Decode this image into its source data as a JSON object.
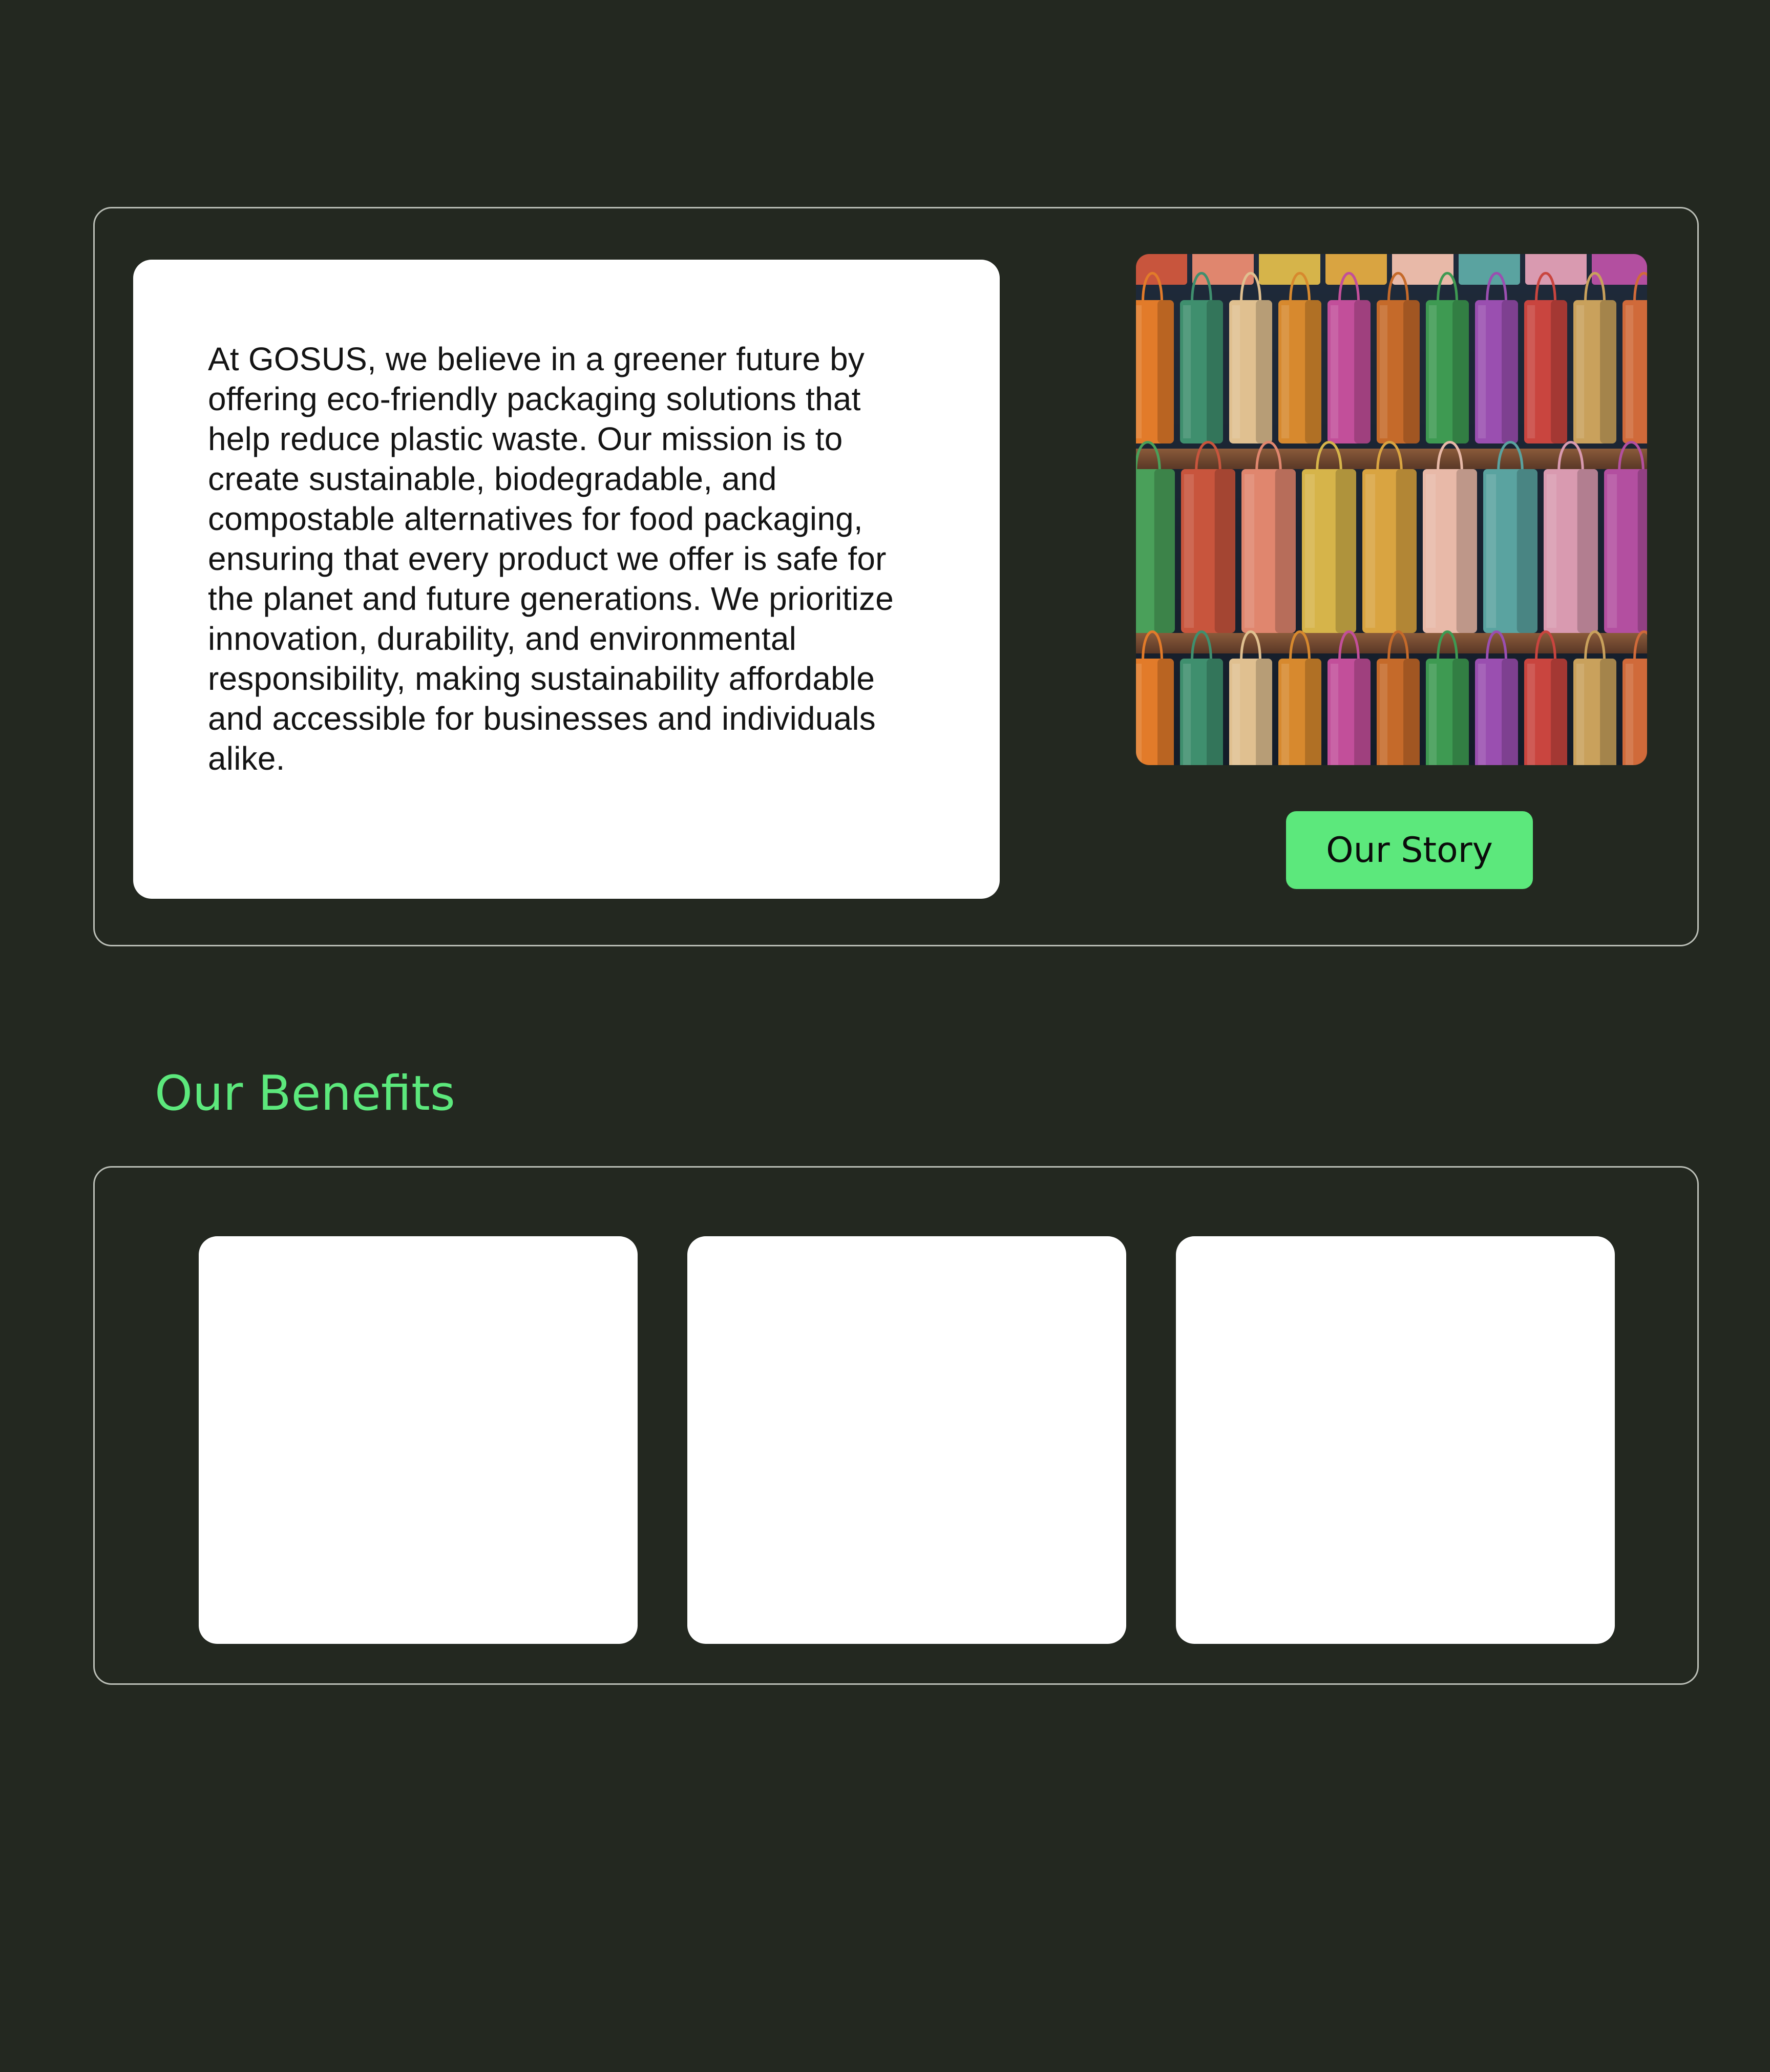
{
  "about": {
    "mission_text": "At GOSUS, we believe in a greener future by offering eco-friendly packaging solutions that help reduce plastic waste. Our mission is to create sustainable, biodegradable, and compostable alternatives for food packaging, ensuring that every product we offer is safe for the planet and future generations. We prioritize innovation, durability, and environmental responsibility, making sustainability affordable and accessible for businesses and individuals alike.",
    "image_icon": "shopping-bags-photo",
    "story_button_label": "Our Story"
  },
  "benefits": {
    "heading": "Our Benefits",
    "cards": [
      {},
      {},
      {}
    ]
  },
  "colors": {
    "background": "#232820",
    "accent": "#5ce87c",
    "card": "#ffffff",
    "panel_border": "#b9bdb5"
  }
}
